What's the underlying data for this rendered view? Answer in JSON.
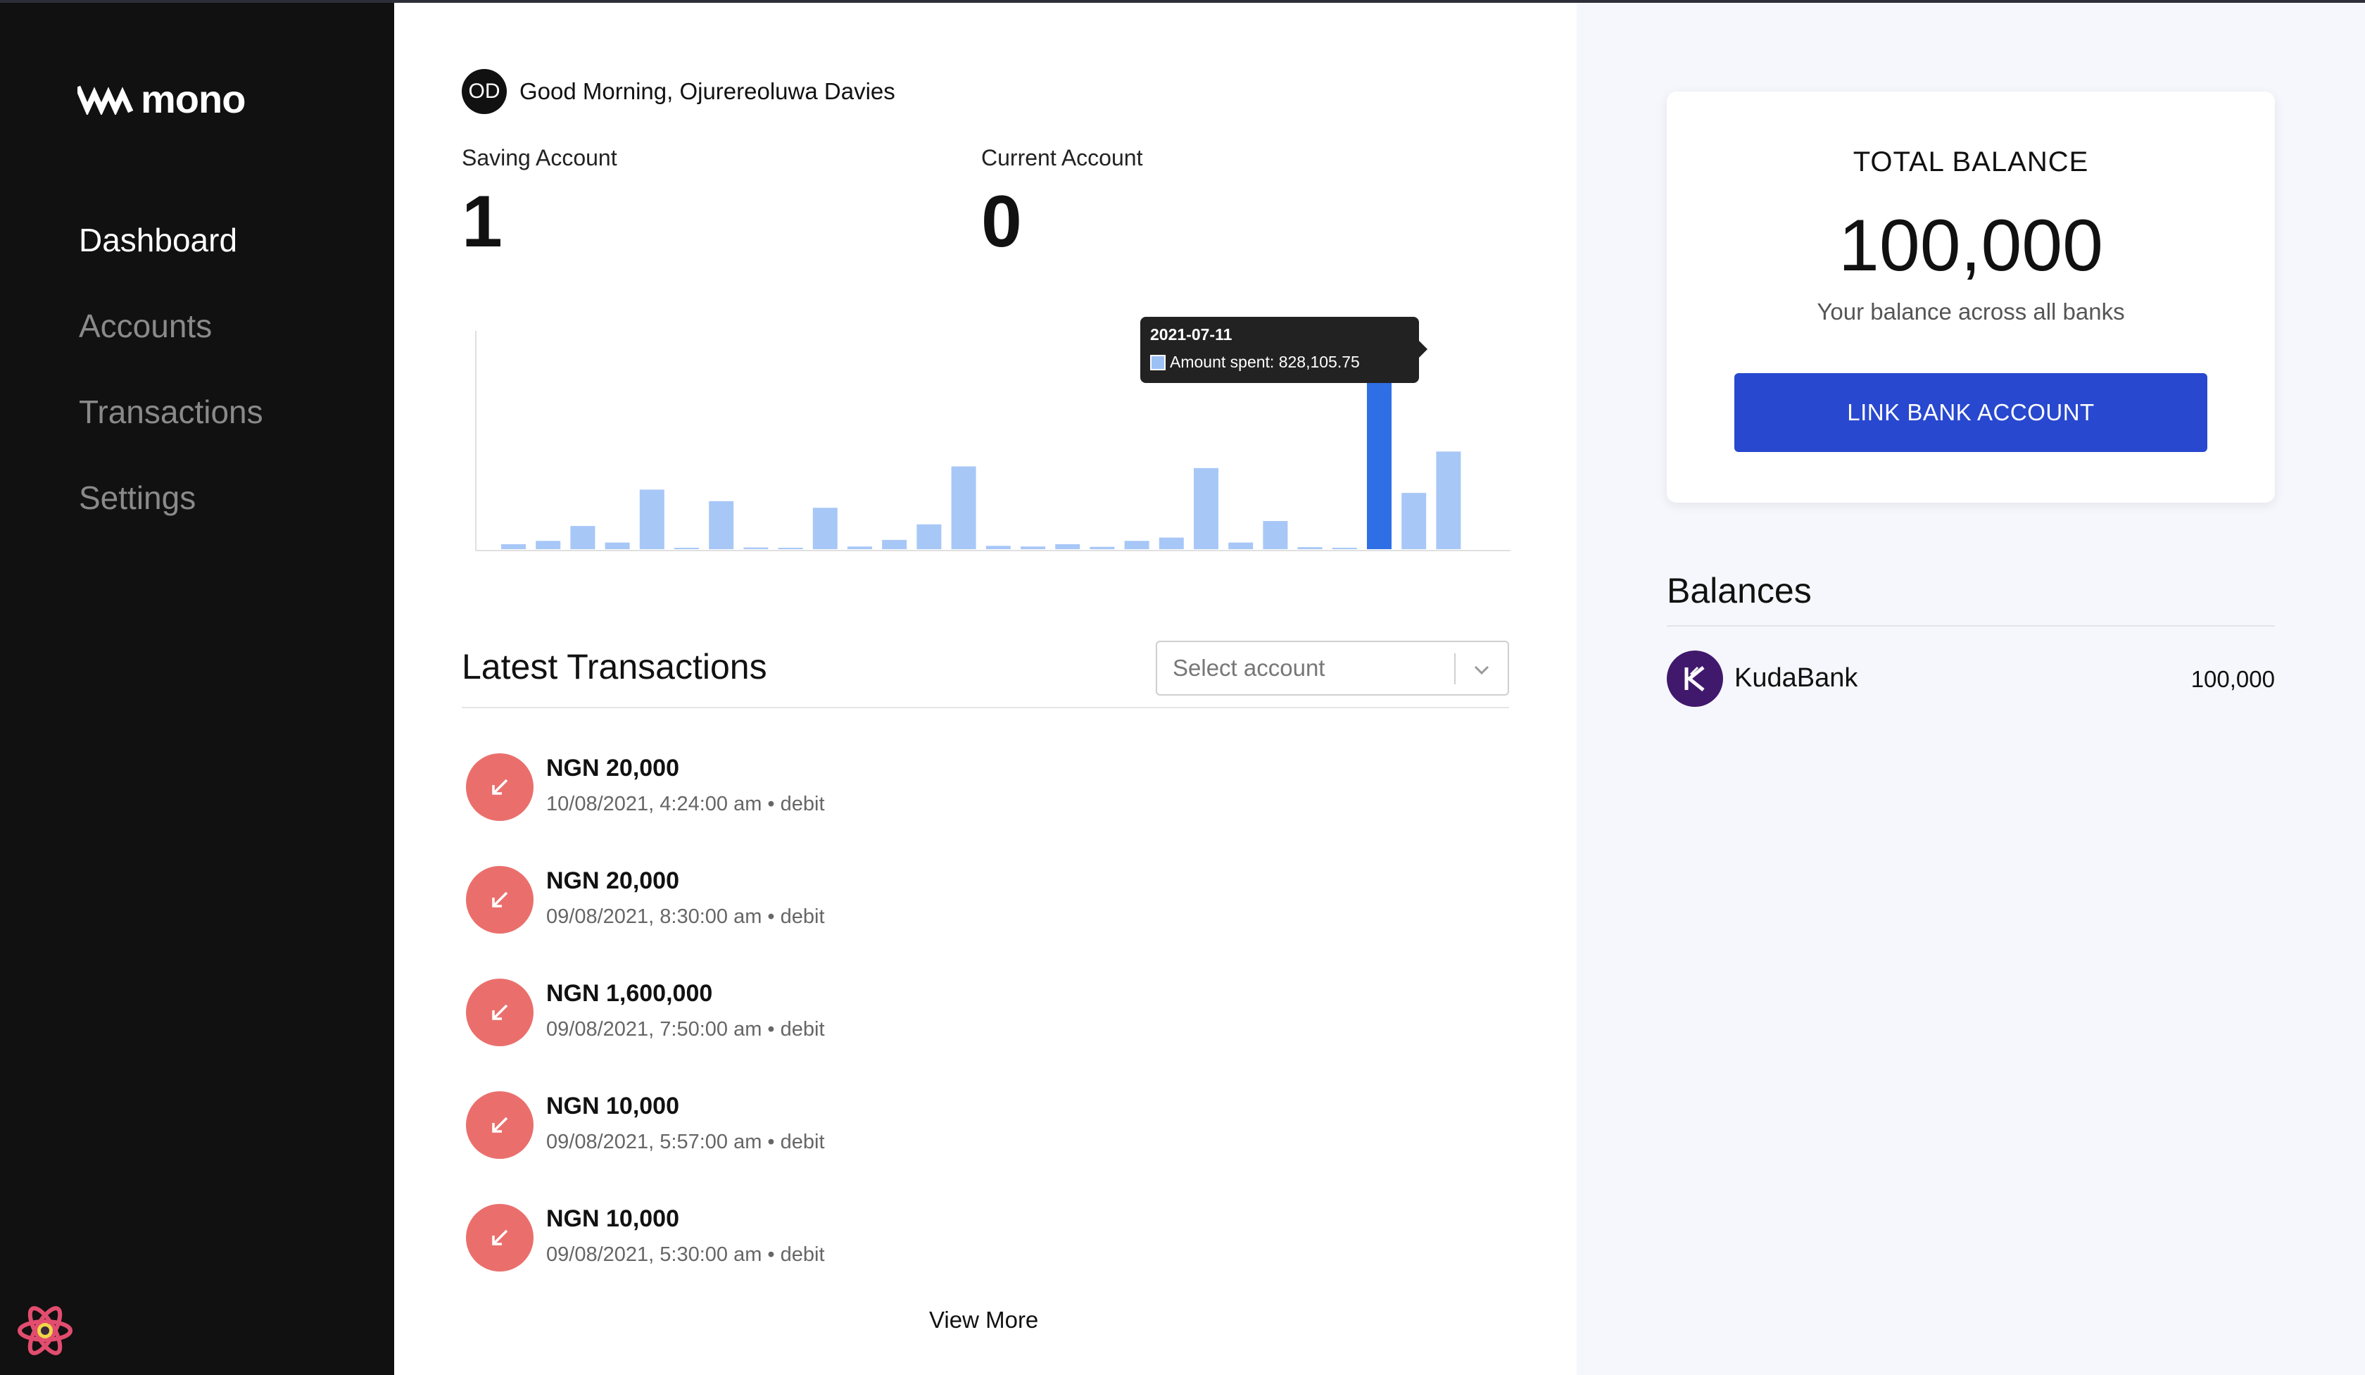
{
  "brand": {
    "name": "mono"
  },
  "sidebar": {
    "items": [
      {
        "label": "Dashboard",
        "active": true
      },
      {
        "label": "Accounts",
        "active": false
      },
      {
        "label": "Transactions",
        "active": false
      },
      {
        "label": "Settings",
        "active": false
      }
    ]
  },
  "header": {
    "avatar_initials": "OD",
    "greeting": "Good Morning, Ojurereoluwa Davies"
  },
  "accounts": {
    "saving": {
      "label": "Saving Account",
      "value": "1"
    },
    "current": {
      "label": "Current Account",
      "value": "0"
    }
  },
  "chart_data": {
    "type": "bar",
    "values": [
      1.5,
      2.5,
      7,
      2,
      18,
      0,
      14.5,
      0.5,
      0,
      12.5,
      0.8,
      2.8,
      7.5,
      25,
      1,
      0.8,
      1.5,
      0.7,
      2.5,
      3.5,
      24.5,
      2,
      8.5,
      0.6,
      0,
      61.7,
      17,
      29.5
    ],
    "highlight_index": 25,
    "tooltip": {
      "date": "2021-07-11",
      "text": "Amount spent: 828,105.75"
    },
    "colors": {
      "bar": "#a7c7f7",
      "highlight": "#2f6fe6"
    }
  },
  "transactions": {
    "title": "Latest Transactions",
    "select_placeholder": "Select account",
    "items": [
      {
        "amount": "NGN 20,000",
        "meta": "10/08/2021, 4:24:00 am • debit"
      },
      {
        "amount": "NGN 20,000",
        "meta": "09/08/2021, 8:30:00 am • debit"
      },
      {
        "amount": "NGN 1,600,000",
        "meta": "09/08/2021, 7:50:00 am • debit"
      },
      {
        "amount": "NGN 10,000",
        "meta": "09/08/2021, 5:57:00 am • debit"
      },
      {
        "amount": "NGN 10,000",
        "meta": "09/08/2021, 5:30:00 am • debit"
      }
    ],
    "view_more": "View More"
  },
  "total_balance": {
    "label": "TOTAL BALANCE",
    "value": "100,000",
    "subtitle": "Your balance across all banks",
    "button": "LINK BANK ACCOUNT"
  },
  "balances": {
    "title": "Balances",
    "banks": [
      {
        "name": "KudaBank",
        "amount": "100,000"
      }
    ]
  },
  "colors": {
    "sidebar_bg": "#111111",
    "accent_button": "#2848cf",
    "debit_icon": "#ea6f6c",
    "right_panel_bg": "#f6f7fc"
  }
}
